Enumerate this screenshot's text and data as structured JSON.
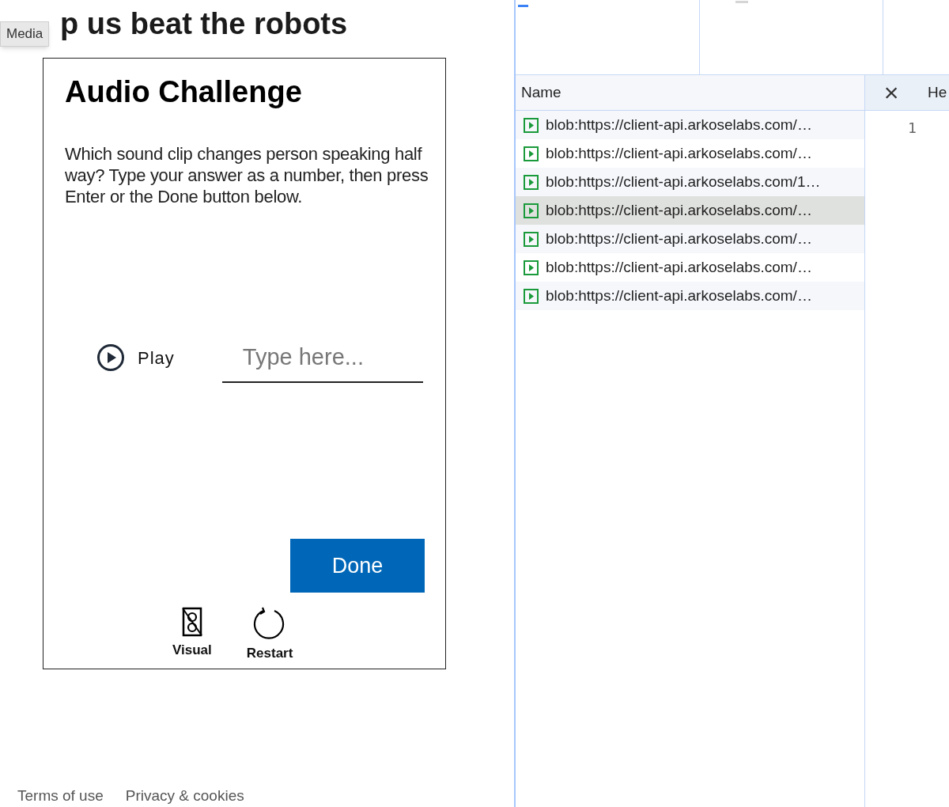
{
  "page": {
    "heading": "p us beat the robots",
    "tooltip": "Media",
    "challenge": {
      "title": "Audio Challenge",
      "instructions": "Which sound clip changes person speaking half way? Type your answer as a number, then press Enter or the Done button below.",
      "play_label": "Play",
      "answer": {
        "placeholder": "Type here..."
      },
      "done_button": "Done",
      "actions": [
        {
          "kind": "visual",
          "label": "Visual"
        },
        {
          "kind": "restart",
          "label": "Restart"
        }
      ]
    },
    "footer_links": [
      "Terms of use",
      "Privacy & cookies"
    ]
  },
  "devtools": {
    "name_column": "Name",
    "close": "×",
    "detail_tab": "He",
    "line_number": "1",
    "requests": [
      {
        "name": "blob:https://client-api.arkoselabs.com/…",
        "selected": false
      },
      {
        "name": "blob:https://client-api.arkoselabs.com/…",
        "selected": false
      },
      {
        "name": "blob:https://client-api.arkoselabs.com/1…",
        "selected": false
      },
      {
        "name": "blob:https://client-api.arkoselabs.com/…",
        "selected": true
      },
      {
        "name": "blob:https://client-api.arkoselabs.com/…",
        "selected": false
      },
      {
        "name": "blob:https://client-api.arkoselabs.com/…",
        "selected": false
      },
      {
        "name": "blob:https://client-api.arkoselabs.com/…",
        "selected": false
      }
    ]
  }
}
